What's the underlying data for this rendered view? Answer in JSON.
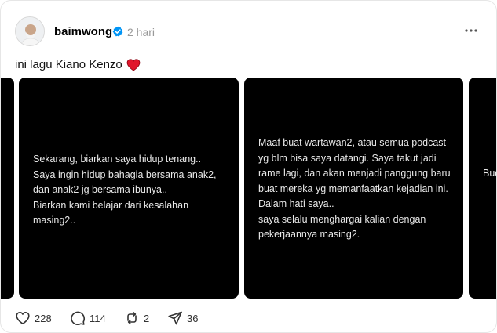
{
  "post": {
    "username": "baimwong",
    "time": "2 hari",
    "caption": "ini lagu Kiano Kenzo",
    "caption_emoji": "heart-emoji"
  },
  "slides": [
    {
      "text": ""
    },
    {
      "text": "Sekarang, biarkan saya hidup tenang..\nSaya ingin hidup bahagia bersama anak2,\ndan anak2 jg bersama ibunya..\nBiarkan kami belajar dari kesalahan\nmasing2.."
    },
    {
      "text": "Maaf buat wartawan2, atau semua podcast\nyg blm bisa saya datangi. Saya takut jadi\nrame lagi, dan akan menjadi panggung baru\nbuat mereka yg memanfaatkan kejadian ini.\nDalam hati saya..\nsaya selalu menghargai kalian dengan\npekerjaannya masing2."
    },
    {
      "text": "Bud"
    }
  ],
  "actions": {
    "likes": "228",
    "replies": "114",
    "reposts": "2",
    "shares": "36"
  },
  "colors": {
    "verified": "#0095f6",
    "heart": "#e0162b",
    "slide_bg": "#000000"
  }
}
